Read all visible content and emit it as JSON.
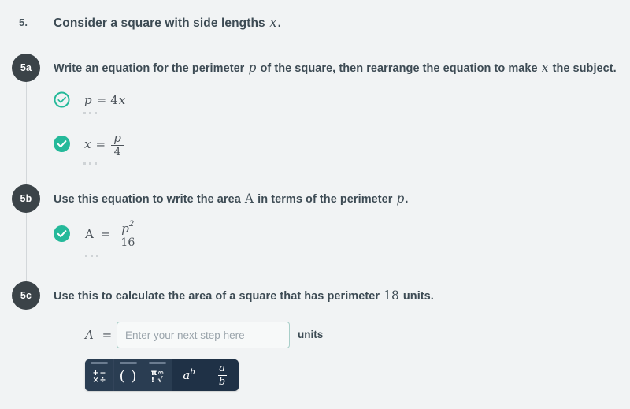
{
  "theme": {
    "page_bg": "#f1f3f4",
    "badge_bg": "#3b4348",
    "check_teal": "#25b99a",
    "input_border": "#a9cfc9",
    "toolbar_bg": "#1f3146",
    "text": "#3d4b54"
  },
  "question": {
    "number": "5.",
    "prompt_before": "Consider a square with side lengths",
    "prompt_var": "x",
    "prompt_after": "."
  },
  "steps": [
    {
      "badge": "5a",
      "text_parts": {
        "a": "Write an equation for the perimeter",
        "var1": "p",
        "b": "of the square, then rearrange the equation to make",
        "var2": "x",
        "c": "the subject."
      },
      "answers": [
        {
          "icon": "check-circle-outline-icon",
          "icon_style": "outline",
          "lhs": "p",
          "eq": "=",
          "rhs_coefficient": "4",
          "rhs_var": "x",
          "rhs_type": "product",
          "ellipsis": "..."
        },
        {
          "icon": "check-circle-filled-icon",
          "icon_style": "filled",
          "lhs": "x",
          "eq": "=",
          "rhs_type": "fraction",
          "rhs_numerator": "p",
          "rhs_denominator": "4",
          "ellipsis": "..."
        }
      ]
    },
    {
      "badge": "5b",
      "text_parts": {
        "a": "Use this equation to write the area",
        "var1": "A",
        "b": "in terms of the perimeter",
        "var2": "p",
        "c": "."
      },
      "answers": [
        {
          "icon": "check-circle-filled-icon",
          "icon_style": "filled",
          "lhs": "A",
          "eq": "=",
          "rhs_type": "fraction",
          "rhs_numerator": "p",
          "rhs_numerator_exponent": "2",
          "rhs_denominator": "16",
          "ellipsis": "..."
        }
      ]
    },
    {
      "badge": "5c",
      "text_parts": {
        "a": "Use this to calculate the area of a square that has perimeter",
        "var1": "18",
        "b": "units.",
        "var2": "",
        "c": ""
      },
      "answers": []
    }
  ],
  "input_row": {
    "label_var": "A",
    "label_eq": "=",
    "placeholder": "Enter your next step here",
    "value": "",
    "units_label": "units"
  },
  "math_toolbar": {
    "keys": [
      {
        "name": "operators-key",
        "type": "grid",
        "glyphs": [
          "+",
          "−",
          "×",
          "÷"
        ],
        "selected_marker": true
      },
      {
        "name": "parentheses-key",
        "type": "text",
        "glyph": "( )",
        "selected_marker": true
      },
      {
        "name": "symbols-key",
        "type": "grid",
        "glyphs": [
          "π",
          "∞",
          "!",
          "√"
        ],
        "selected_marker": true
      },
      {
        "name": "exponent-key",
        "type": "superscript",
        "base": "a",
        "exponent": "b",
        "selected_marker": false
      },
      {
        "name": "fraction-key",
        "type": "fraction",
        "numerator": "a",
        "denominator": "b",
        "selected_marker": false
      }
    ]
  }
}
